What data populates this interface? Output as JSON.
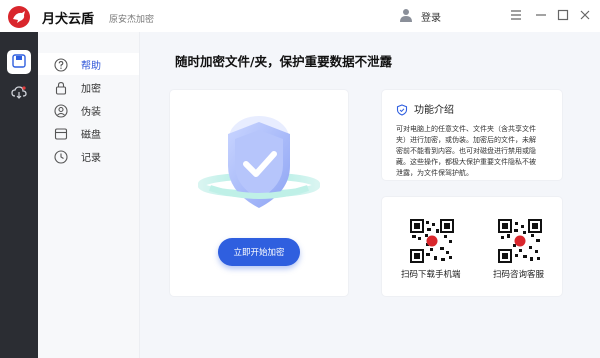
{
  "app": {
    "name": "月犬云盾",
    "subtitle": "原安杰加密"
  },
  "header": {
    "login_label": "登录"
  },
  "window_controls": {
    "menu": "menu-icon",
    "minimize": "minimize-icon",
    "maximize": "maximize-icon",
    "close": "close-icon"
  },
  "rail": {
    "items": [
      {
        "icon": "floppy-disk-icon",
        "active": true
      },
      {
        "icon": "cloud-sync-icon",
        "active": false
      }
    ]
  },
  "sidebar": {
    "items": [
      {
        "label": "帮助",
        "icon": "help-circle-icon",
        "active": true
      },
      {
        "label": "加密",
        "icon": "lock-icon",
        "active": false
      },
      {
        "label": "伪装",
        "icon": "user-mask-icon",
        "active": false
      },
      {
        "label": "磁盘",
        "icon": "disk-icon",
        "active": false
      },
      {
        "label": "记录",
        "icon": "clock-icon",
        "active": false
      }
    ]
  },
  "main": {
    "headline": "随时加密文件/夹，保护重要数据不泄露",
    "start_button": "立即开始加密",
    "feature": {
      "title": "功能介绍",
      "lines": [
        "可对电脑上的任意文件、文件夹（含共享文件",
        "夹）进行加密，或伪装。加密后的文件，未解",
        "密前不能看到内容。也可对磁盘进行禁用或隐",
        "藏。这些操作，都极大保护重要文件隐私不被",
        "泄露，为文件保驾护航。"
      ]
    },
    "qr": [
      {
        "label": "扫码下载手机端"
      },
      {
        "label": "扫码咨询客服"
      }
    ]
  },
  "colors": {
    "accent": "#2f5fdf",
    "rail": "#2b2d33",
    "brand": "#d9262c"
  }
}
